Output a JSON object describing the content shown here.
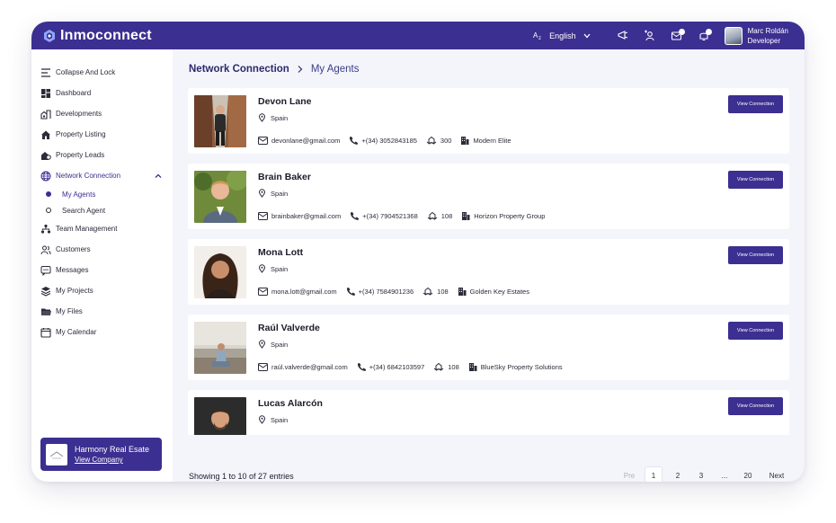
{
  "header": {
    "brand": "Inmoconnect",
    "language": "English",
    "user": {
      "name": "Marc Roldán",
      "role": "Developer"
    }
  },
  "sidebar": {
    "items": [
      {
        "label": "Collapse And Lock",
        "icon": "menu-icon"
      },
      {
        "label": "Dashboard",
        "icon": "dashboard-icon"
      },
      {
        "label": "Developments",
        "icon": "developments-icon"
      },
      {
        "label": "Property Listing",
        "icon": "house-icon"
      },
      {
        "label": "Property Leads",
        "icon": "property-leads-icon"
      },
      {
        "label": "Network Connection",
        "icon": "globe-icon"
      },
      {
        "label": "Team Management",
        "icon": "team-icon"
      },
      {
        "label": "Customers",
        "icon": "customers-icon"
      },
      {
        "label": "Messages",
        "icon": "messages-icon"
      },
      {
        "label": "My Projects",
        "icon": "layers-icon"
      },
      {
        "label": "My Files",
        "icon": "folder-icon"
      },
      {
        "label": "My Calendar",
        "icon": "calendar-icon"
      }
    ],
    "subitems": [
      {
        "label": "My Agents"
      },
      {
        "label": "Search Agent"
      }
    ],
    "company": {
      "name": "Harmony Real Esate",
      "link": "View Company"
    }
  },
  "breadcrumb": {
    "root": "Network Connection",
    "current": "My Agents"
  },
  "agents": [
    {
      "name": "Devon Lane",
      "location": "Spain",
      "email": "devonlane@gmail.com",
      "phone": "+(34) 3052843185",
      "count": "300",
      "company": "Modern Elite",
      "button": "View Connection"
    },
    {
      "name": "Brain Baker",
      "location": "Spain",
      "email": "brainbaker@gmail.com",
      "phone": "+(34) 7904521368",
      "count": "108",
      "company": "Horizon Property Group",
      "button": "View Connection"
    },
    {
      "name": "Mona Lott",
      "location": "Spain",
      "email": "mona.lott@gmail.com",
      "phone": "+(34) 7584901236",
      "count": "108",
      "company": "Golden Key Estates",
      "button": "View Connection"
    },
    {
      "name": "Raúl Valverde",
      "location": "Spain",
      "email": "raúl.valverde@gmail.com",
      "phone": "+(34) 6842103597",
      "count": "108",
      "company": "BlueSky Property Solutions",
      "button": "View Connection"
    },
    {
      "name": "Lucas Alarcón",
      "location": "Spain",
      "email": "",
      "phone": "",
      "count": "",
      "company": "",
      "button": "View Connection"
    }
  ],
  "pagination": {
    "summary": "Showing 1 to 10 of 27 entries",
    "prev": "Pre",
    "pages": [
      "1",
      "2",
      "3",
      "...",
      "20"
    ],
    "next": "Next"
  },
  "colors": {
    "primary": "#3b2f91",
    "background": "#f4f5fb"
  }
}
